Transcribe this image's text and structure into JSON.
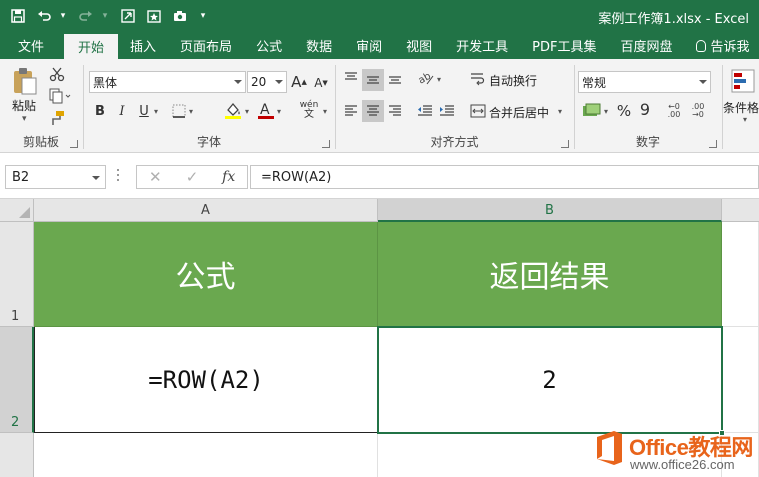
{
  "window": {
    "title": "案例工作簿1.xlsx - Excel"
  },
  "quick_access": {
    "save_icon": "save-icon",
    "undo_icon": "undo-icon",
    "redo_icon": "redo-icon",
    "items": [
      "save",
      "undo",
      "redo",
      "touch-mode",
      "form",
      "camera",
      "customize"
    ]
  },
  "tabs": [
    {
      "label": "文件"
    },
    {
      "label": "开始"
    },
    {
      "label": "插入"
    },
    {
      "label": "页面布局"
    },
    {
      "label": "公式"
    },
    {
      "label": "数据"
    },
    {
      "label": "审阅"
    },
    {
      "label": "视图"
    },
    {
      "label": "开发工具"
    },
    {
      "label": "PDF工具集"
    },
    {
      "label": "百度网盘"
    },
    {
      "label": "告诉我"
    }
  ],
  "active_tab": "开始",
  "ribbon": {
    "clipboard": {
      "paste_label": "粘贴",
      "group_label": "剪贴板"
    },
    "font": {
      "font_name": "黑体",
      "font_size": "20",
      "bold": "B",
      "italic": "I",
      "underline": "U",
      "grow": "A",
      "shrink": "A",
      "wen": "wén",
      "group_label": "字体"
    },
    "alignment": {
      "wrap_text": "自动换行",
      "merge_center": "合并后居中",
      "group_label": "对齐方式"
    },
    "number": {
      "format": "常规",
      "percent": "%",
      "comma": "9",
      "group_label": "数字"
    },
    "styles": {
      "conditional_label": "条件格式"
    }
  },
  "formula_bar": {
    "name_box": "B2",
    "cancel": "✕",
    "enter": "✓",
    "fx": "fx",
    "formula": "=ROW(A2)"
  },
  "sheet": {
    "columns": [
      "A",
      "B"
    ],
    "rows": [
      "1",
      "2"
    ],
    "selected_cell": "B2",
    "cells": {
      "A1": "公式",
      "B1": "返回结果",
      "A2": "=ROW(A2)",
      "B2": "2"
    },
    "colors": {
      "header_fill": "#6aa84f",
      "header_text": "#ffffff",
      "accent": "#217346"
    }
  },
  "watermark": {
    "title": "Office教程网",
    "url": "www.office26.com"
  }
}
